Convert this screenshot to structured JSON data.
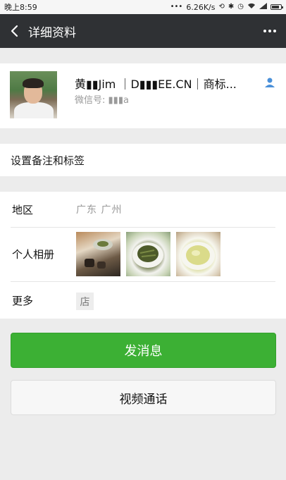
{
  "status_bar": {
    "time": "晚上8:59",
    "dots": "•••",
    "speed": "6.26K/s"
  },
  "header": {
    "title": "详细资料"
  },
  "profile": {
    "name": "黄▮▮Jim ｜D▮▮▮EE.CN｜商标...",
    "wechat_label": "微信号: ▮▮▮a"
  },
  "remark": {
    "label": "设置备注和标签"
  },
  "info": {
    "region_label": "地区",
    "region_value": "广东  广州",
    "album_label": "个人相册",
    "more_label": "更多",
    "shop_glyph": "店"
  },
  "actions": {
    "send_message": "发消息",
    "video_call": "视频通话"
  },
  "colors": {
    "header_bg": "#2f3134",
    "primary_green": "#3cb034",
    "page_bg": "#ececec"
  }
}
